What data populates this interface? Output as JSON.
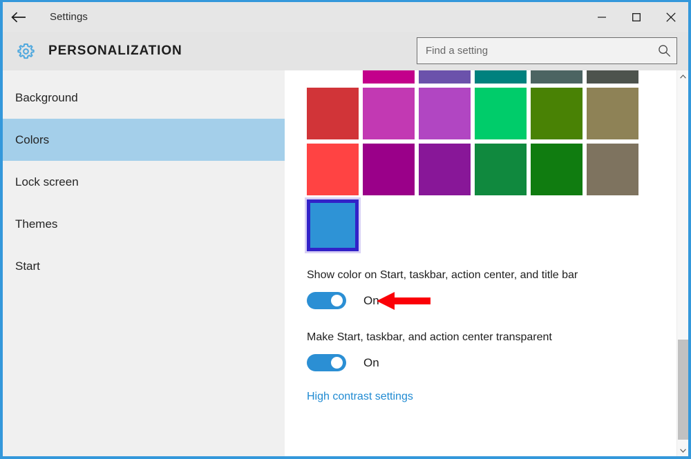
{
  "window": {
    "app_title": "Settings",
    "border_color": "#3498db",
    "back_icon": "back-arrow-icon",
    "controls": {
      "minimize": "minimize-icon",
      "maximize": "maximize-icon",
      "close": "close-icon"
    }
  },
  "header": {
    "page_title": "PERSONALIZATION",
    "gear_icon": "gear-icon",
    "gear_color": "#4fa8de"
  },
  "search": {
    "placeholder": "Find a setting",
    "value": "",
    "icon": "search-icon"
  },
  "sidebar": {
    "selected_color": "#a4cfea",
    "items": [
      {
        "label": "Background",
        "selected": false
      },
      {
        "label": "Colors",
        "selected": true
      },
      {
        "label": "Lock screen",
        "selected": false
      },
      {
        "label": "Themes",
        "selected": false
      },
      {
        "label": "Start",
        "selected": false
      }
    ]
  },
  "content": {
    "swatches": {
      "columns": 6,
      "selected_index": 18,
      "selection_border_color": "#3222c8",
      "colors": [
        "#f26d४4",
        "#c3008b",
        "#6b52ab",
        "#00817e",
        "#4c6462",
        "#4d534d",
        "#d13438",
        "#c239b3",
        "#b146c2",
        "#00cc6a",
        "#498205",
        "#8e8256",
        "#ff4343",
        "#9a0089",
        "#881798",
        "#10893e",
        "#107c10",
        "#7e735f",
        "#2e93d6"
      ]
    },
    "settings": [
      {
        "label": "Show color on Start, taskbar, action center, and title bar",
        "toggle_state": "On",
        "toggle_on": true
      },
      {
        "label": "Make Start, taskbar, and action center transparent",
        "toggle_state": "On",
        "toggle_on": true
      }
    ],
    "link": "High contrast settings",
    "link_color": "#1f8ad2",
    "toggle_color": "#2b8fd4"
  },
  "annotation": {
    "arrow": "red-left-arrow",
    "color": "#fb0007"
  },
  "scrollbar": {
    "up_icon": "chevron-up-icon",
    "down_icon": "chevron-down-icon"
  }
}
